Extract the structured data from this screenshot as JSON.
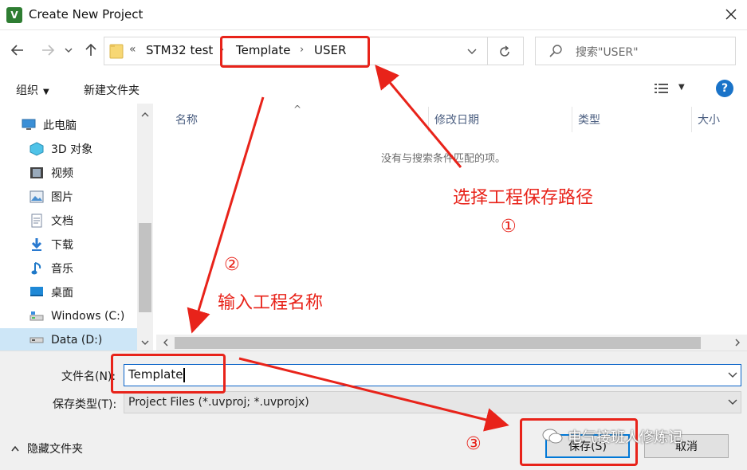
{
  "window": {
    "title": "Create New Project",
    "app_icon_text": "V"
  },
  "address_bar": {
    "crumbs": [
      "«",
      "STM32 test",
      "Template",
      "USER"
    ],
    "separators": [
      "›",
      "›"
    ],
    "search_placeholder": "搜索\"USER\""
  },
  "toolbar": {
    "organize": "组织",
    "new_folder": "新建文件夹"
  },
  "nav_pane": {
    "items": [
      {
        "label": "此电脑",
        "icon": "computer-icon"
      },
      {
        "label": "3D 对象",
        "icon": "3d-objects-icon"
      },
      {
        "label": "视频",
        "icon": "video-icon"
      },
      {
        "label": "图片",
        "icon": "pictures-icon"
      },
      {
        "label": "文档",
        "icon": "documents-icon"
      },
      {
        "label": "下载",
        "icon": "download-icon"
      },
      {
        "label": "音乐",
        "icon": "music-icon"
      },
      {
        "label": "桌面",
        "icon": "desktop-icon"
      },
      {
        "label": "Windows (C:)",
        "icon": "drive-c-icon"
      },
      {
        "label": "Data (D:)",
        "icon": "drive-d-icon",
        "selected": true
      }
    ]
  },
  "file_list": {
    "columns": [
      "名称",
      "修改日期",
      "类型",
      "大小"
    ],
    "empty_message": "没有与搜索条件匹配的项。"
  },
  "form": {
    "filename_label": "文件名(N):",
    "filename_value": "Template",
    "filetype_label": "保存类型(T):",
    "filetype_value": "Project Files (*.uvproj; *.uvprojx)"
  },
  "footer": {
    "hide_folders": "隐藏文件夹",
    "save_button": "保存(S)",
    "cancel_button": "取消"
  },
  "annotations": {
    "step1_text": "选择工程保存路径",
    "step1_num": "①",
    "step2_text": "输入工程名称",
    "step2_num": "②",
    "step3_num": "③",
    "color": "#e8231a"
  },
  "watermark": {
    "text": "电气接班人修炼记"
  },
  "colors": {
    "accent": "#0078d7",
    "selection": "#cde6f7",
    "annotation": "#e8231a"
  }
}
